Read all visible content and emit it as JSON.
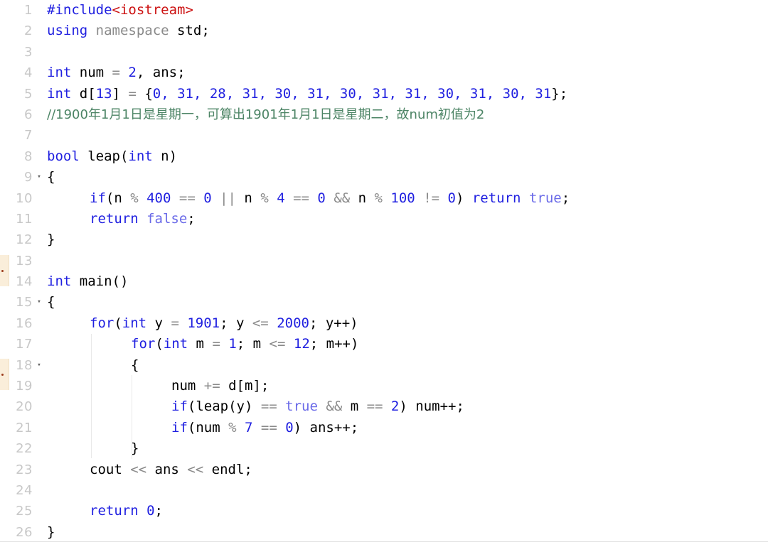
{
  "app": {
    "type": "code-editor",
    "language": "C++",
    "theme": "light",
    "background_color": "#ffffff",
    "gutter_color": "#c8c8c8"
  },
  "colors": {
    "keyword": "#1f1fe0",
    "preprocessor": "#2020e0",
    "header": "#cc1111",
    "number": "#2020e0",
    "boolean_literal": "#6a6ae8",
    "operator": "#8a8a8a",
    "comment": "#4c8465",
    "plain_text": "#000000",
    "line_number": "#c8c8c8",
    "change_marker": "#faeeda",
    "change_marker_dot": "#9b3b1c",
    "indent_guide": "#e8e8e8"
  },
  "gutter": {
    "line_numbers": [
      1,
      2,
      3,
      4,
      5,
      6,
      7,
      8,
      9,
      10,
      11,
      12,
      13,
      14,
      15,
      16,
      17,
      18,
      19,
      20,
      21,
      22,
      23,
      24,
      25,
      26
    ],
    "fold_markers": [
      9,
      15,
      18
    ],
    "fold_glyph": "▾",
    "change_marker_lines": [
      13,
      18
    ]
  },
  "code": {
    "full_text": "#include<iostream>\nusing namespace std;\n\nint num = 2, ans;\nint d[13] = {0, 31, 28, 31, 30, 31, 30, 31, 31, 30, 31, 30, 31};\n//1900年1月1日是星期一，可算出1901年1月1日是星期二，故num初值为2\n\nbool leap(int n)\n{\n    if(n % 400 == 0 || n % 4 == 0 && n % 100 != 0) return true;\n    return false;\n}\n\nint main()\n{\n    for(int y = 1901; y <= 2000; y++)\n        for(int m = 1; m <= 12; m++)\n        {\n            num += d[m];\n            if(leap(y) == true && m == 2) num++;\n            if(num % 7 == 0) ans++;\n        }\n    cout << ans << endl;\n\n    return 0;\n}",
    "lines": [
      {
        "n": 1,
        "text": "#include<iostream>"
      },
      {
        "n": 2,
        "text": "using namespace std;"
      },
      {
        "n": 3,
        "text": ""
      },
      {
        "n": 4,
        "text": "int num = 2, ans;"
      },
      {
        "n": 5,
        "text": "int d[13] = {0, 31, 28, 31, 30, 31, 30, 31, 31, 30, 31, 30, 31};"
      },
      {
        "n": 6,
        "text": "//1900年1月1日是星期一，可算出1901年1月1日是星期二，故num初值为2"
      },
      {
        "n": 7,
        "text": ""
      },
      {
        "n": 8,
        "text": "bool leap(int n)"
      },
      {
        "n": 9,
        "text": "{"
      },
      {
        "n": 10,
        "text": "    if(n % 400 == 0 || n % 4 == 0 && n % 100 != 0) return true;"
      },
      {
        "n": 11,
        "text": "    return false;"
      },
      {
        "n": 12,
        "text": "}"
      },
      {
        "n": 13,
        "text": ""
      },
      {
        "n": 14,
        "text": "int main()"
      },
      {
        "n": 15,
        "text": "{"
      },
      {
        "n": 16,
        "text": "    for(int y = 1901; y <= 2000; y++)"
      },
      {
        "n": 17,
        "text": "        for(int m = 1; m <= 12; m++)"
      },
      {
        "n": 18,
        "text": "        {"
      },
      {
        "n": 19,
        "text": "            num += d[m];"
      },
      {
        "n": 20,
        "text": "            if(leap(y) == true && m == 2) num++;"
      },
      {
        "n": 21,
        "text": "            if(num % 7 == 0) ans++;"
      },
      {
        "n": 22,
        "text": "        }"
      },
      {
        "n": 23,
        "text": "    cout << ans << endl;"
      },
      {
        "n": 24,
        "text": ""
      },
      {
        "n": 25,
        "text": "    return 0;"
      },
      {
        "n": 26,
        "text": "}"
      }
    ],
    "tokens": {
      "l1_include": "#include",
      "l1_header": "<iostream>",
      "l2_using": "using",
      "l2_namespace": " namespace ",
      "l2_std": "std;",
      "l4_int": "int",
      "l4_rest_a": " num ",
      "l4_eq": "=",
      "l4_num": " 2",
      "l4_rest_b": ", ans;",
      "l5_int": "int",
      "l5_d": " d[",
      "l5_13": "13",
      "l5_close": "] ",
      "l5_eq": "=",
      "l5_brace": " {",
      "l5_values": "0, 31, 28, 31, 30, 31, 30, 31, 31, 30, 31, 30, 31",
      "l5_end": "};",
      "l6_comment": "//1900年1月1日是星期一，可算出1901年1月1日是星期二，故num初值为2",
      "l8_bool": "bool",
      "l8_name": " leap(",
      "l8_int": "int",
      "l8_param": " n)",
      "l9_brace": "{",
      "l10_if": "if",
      "l10_p1": "(n ",
      "l10_mod1": "%",
      "l10_400": " 400 ",
      "l10_eq1": "==",
      "l10_z1": " 0",
      "l10_or": " || ",
      "l10_n2": "n ",
      "l10_mod2": "%",
      "l10_4": " 4 ",
      "l10_eq2": "==",
      "l10_z2": " 0",
      "l10_and": " && ",
      "l10_n3": "n ",
      "l10_mod3": "%",
      "l10_100": " 100 ",
      "l10_neq": "!=",
      "l10_z3": " 0",
      "l10_close": ") ",
      "l10_return": "return",
      "l10_true": " true",
      "l10_semi": ";",
      "l11_return": "return",
      "l11_false": " false",
      "l11_semi": ";",
      "l12_brace": "}",
      "l14_int": "int",
      "l14_main": " main()",
      "l15_brace": "{",
      "l16_for": "for",
      "l16_p1": "(",
      "l16_int": "int",
      "l16_y": " y ",
      "l16_eq": "=",
      "l16_1901": " 1901",
      "l16_semi1": "; y ",
      "l16_le": "<=",
      "l16_2000": " 2000",
      "l16_end": "; y++)",
      "l17_for": "for",
      "l17_p1": "(",
      "l17_int": "int",
      "l17_m": " m ",
      "l17_eq": "=",
      "l17_1": " 1",
      "l17_semi1": "; m ",
      "l17_le": "<=",
      "l17_12": " 12",
      "l17_end": "; m++)",
      "l18_brace": "{",
      "l19_num": "num ",
      "l19_pluseq": "+=",
      "l19_d": " d[m];",
      "l20_if": "if",
      "l20_call": "(leap(y) ",
      "l20_eq": "==",
      "l20_true": " true",
      "l20_and": " && ",
      "l20_m": "m ",
      "l20_eq2": "==",
      "l20_2": " 2",
      "l20_end": ") num++;",
      "l21_if": "if",
      "l21_p1": "(num ",
      "l21_mod": "%",
      "l21_7": " 7 ",
      "l21_eq": "==",
      "l21_z": " 0",
      "l21_end": ") ans++;",
      "l22_brace": "}",
      "l23_cout": "cout ",
      "l23_shift1": "<<",
      "l23_ans": " ans ",
      "l23_shift2": "<<",
      "l23_endl": " endl;",
      "l25_return": "return",
      "l25_zero": " 0",
      "l25_semi": ";",
      "l26_brace": "}"
    }
  }
}
